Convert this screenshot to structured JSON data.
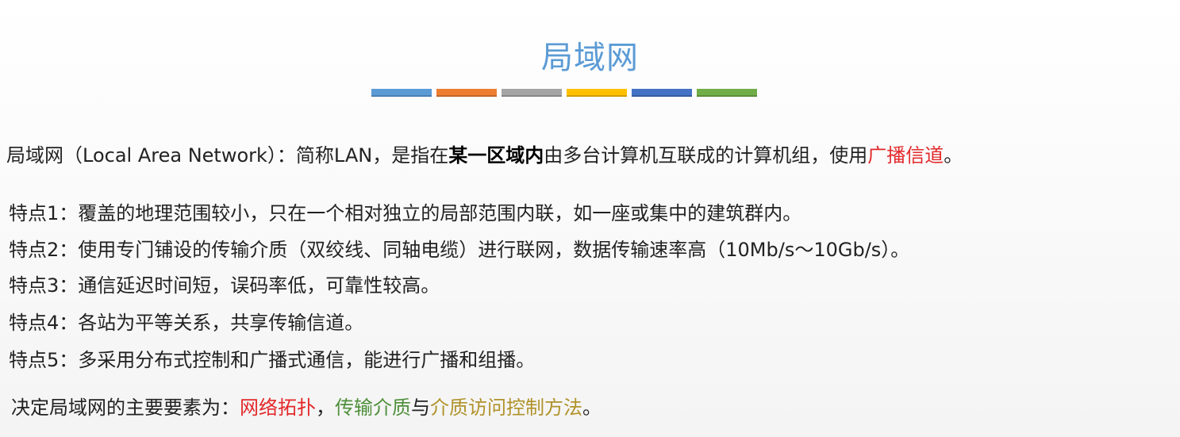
{
  "title": "局域网",
  "color_bars": [
    "#5b9bd5",
    "#ed7d31",
    "#a5a5a5",
    "#ffc000",
    "#4472c4",
    "#70ad47"
  ],
  "definition": {
    "prefix": "局域网（Local Area Network）：简称LAN，是指在",
    "bold": "某一区域内",
    "middle": "由多台计算机互联成的计算机组，使用",
    "highlight": "广播信道",
    "suffix": "。"
  },
  "features": [
    "特点1：覆盖的地理范围较小，只在一个相对独立的局部范围内联，如一座或集中的建筑群内。",
    "特点2：使用专门铺设的传输介质（双绞线、同轴电缆）进行联网，数据传输速率高（10Mb/s～10Gb/s）。",
    "特点3：通信延迟时间短，误码率低，可靠性较高。",
    "特点4：各站为平等关系，共享传输信道。",
    "特点5：多采用分布式控制和广播式通信，能进行广播和组播。"
  ],
  "summary": {
    "prefix": "决定局域网的主要要素为：",
    "item1": "网络拓扑",
    "sep1": "，",
    "item2": "传输介质",
    "sep2": "与",
    "item3": "介质访问控制方法",
    "suffix": "。"
  },
  "colors": {
    "title": "#5b9bd5",
    "red": "#e3282a",
    "green": "#4e8f3a",
    "olive": "#b0922a"
  }
}
